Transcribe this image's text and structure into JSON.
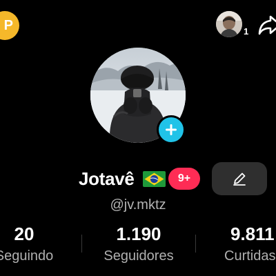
{
  "topbar": {
    "coin_icon_label": "P",
    "visitor_count": "1"
  },
  "profile": {
    "display_name": "Jotavê",
    "flag": "brazil-flag",
    "notification_badge": "9+",
    "username": "@jv.mktz"
  },
  "stats": {
    "following": {
      "value": "20",
      "label": "Seguindo"
    },
    "followers": {
      "value": "1.190",
      "label": "Seguidores"
    },
    "likes": {
      "value": "9.811",
      "label": "Curtidas"
    }
  },
  "colors": {
    "background": "#000000",
    "coin": "#f5b82a",
    "add_story": "#20c3e8",
    "badge": "#fe2c55",
    "edit_button": "#2f2f2f"
  }
}
